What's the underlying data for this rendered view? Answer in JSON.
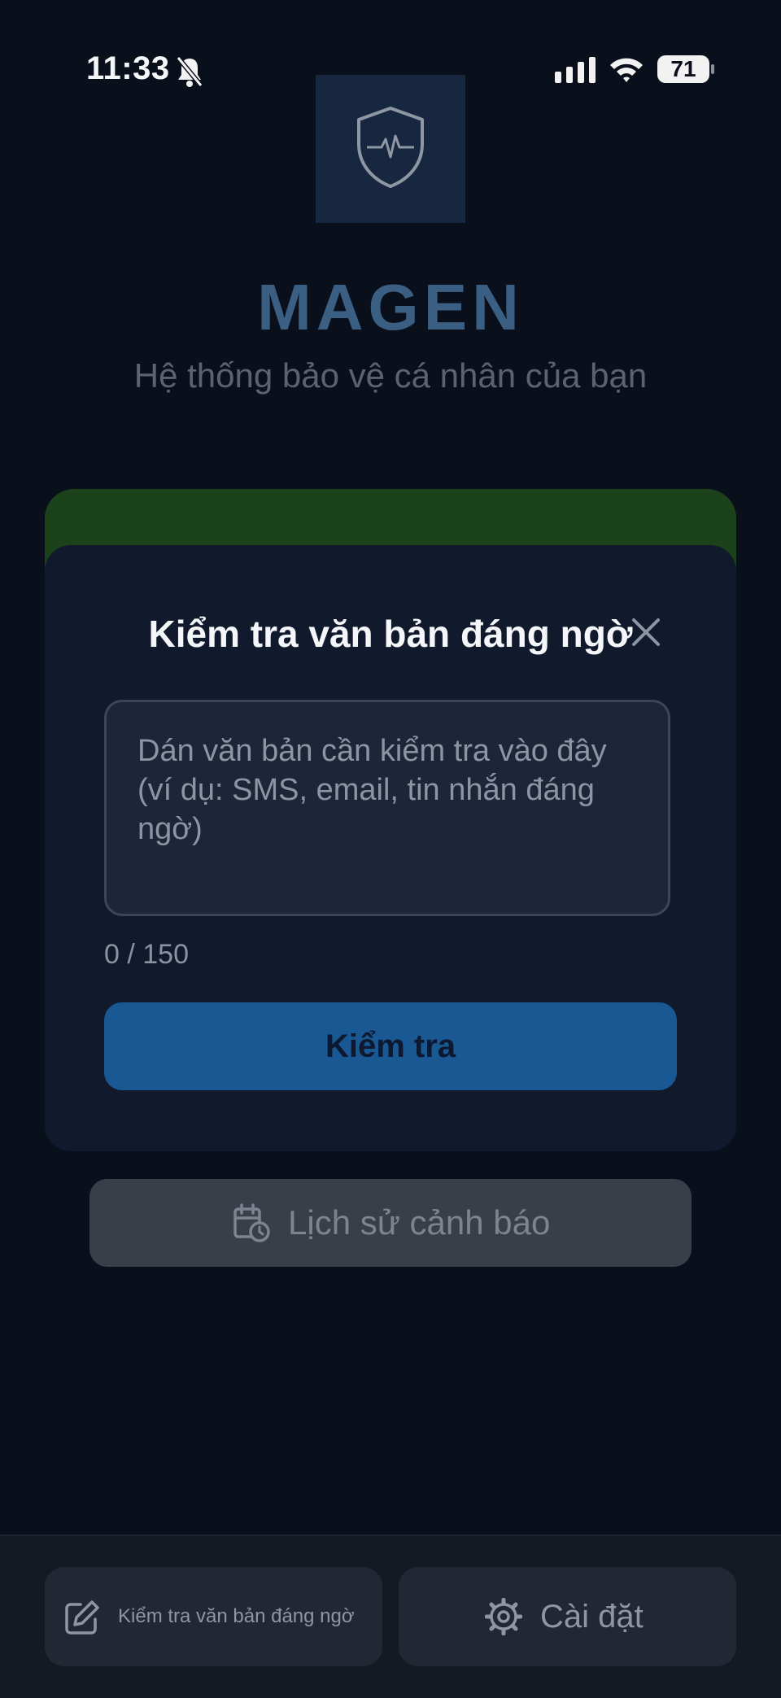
{
  "status_bar": {
    "time": "11:33",
    "battery": "71",
    "icons": [
      "bell-slash-icon",
      "signal-icon",
      "wifi-icon",
      "battery-icon"
    ]
  },
  "app": {
    "title": "MAGEN",
    "subtitle": "Hệ thống bảo vệ cá nhân của bạn",
    "logo_icon": "shield-pulse-icon"
  },
  "modal": {
    "title": "Kiểm tra văn bản đáng ngờ",
    "close_icon": "close-icon",
    "input_value": "",
    "input_placeholder": "Dán văn bản cần kiểm tra vào đây (ví dụ: SMS, email, tin nhắn đáng ngờ)",
    "counter": "0 / 150",
    "submit_label": "Kiểm tra"
  },
  "history": {
    "label": "Lịch sử cảnh báo",
    "icon": "calendar-clock-icon"
  },
  "bottom_nav": {
    "left_label": "Kiểm tra văn bản đáng ngờ",
    "left_icon": "edit-icon",
    "right_label": "Cài đặt",
    "right_icon": "gear-icon"
  },
  "colors": {
    "background": "#0a0f1c",
    "brand": "#3a5f82",
    "green_card": "#1c421b",
    "modal_bg": "#101a2c",
    "primary_button": "#1a5894"
  }
}
